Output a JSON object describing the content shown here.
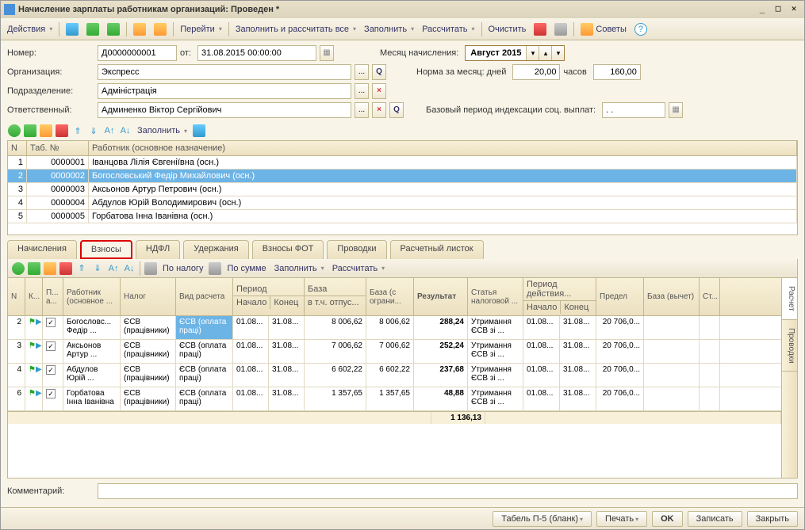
{
  "title": "Начисление зарплаты работникам организаций: Проведен *",
  "toolbar": {
    "actions": "Действия",
    "goto": "Перейти",
    "fill_calc_all": "Заполнить и рассчитать все",
    "fill": "Заполнить",
    "calc": "Рассчитать",
    "clear": "Очистить",
    "tips": "Советы"
  },
  "form": {
    "number_label": "Номер:",
    "number_value": "Д0000000001",
    "date_label": "от:",
    "date_value": "31.08.2015 00:00:00",
    "org_label": "Организация:",
    "org_value": "Экспресс",
    "dept_label": "Подразделение:",
    "dept_value": "Адміністрація",
    "resp_label": "Ответственный:",
    "resp_value": "Админенко Віктор Сергійович",
    "month_label": "Месяц начисления:",
    "month_value": "Август 2015",
    "norm_label": "Норма за месяц: дней",
    "norm_days": "20,00",
    "norm_hours_label": "часов",
    "norm_hours": "160,00",
    "base_period_label": "Базовый период индексации соц. выплат:",
    "base_period_value": ". ."
  },
  "mini_tb": {
    "fill": "Заполнить"
  },
  "emp_grid": {
    "col_n": "N",
    "col_tab": "Таб. №",
    "col_emp": "Работник (основное назначение)",
    "rows": [
      {
        "n": "1",
        "tab": "0000001",
        "emp": "Іванцова Лілія Євгеніївна (осн.)"
      },
      {
        "n": "2",
        "tab": "0000002",
        "emp": "Богословський Федір Михайлович (осн.)"
      },
      {
        "n": "3",
        "tab": "0000003",
        "emp": "Аксьонов Артур Петрович (осн.)"
      },
      {
        "n": "4",
        "tab": "0000004",
        "emp": "Абдулов Юрій Володимирович (осн.)"
      },
      {
        "n": "5",
        "tab": "0000005",
        "emp": "Горбатова Інна Іванівна (осн.)"
      }
    ]
  },
  "tabs": {
    "accruals": "Начисления",
    "contrib": "Взносы",
    "ndfl": "НДФЛ",
    "deduct": "Удержания",
    "contrib_fot": "Взносы ФОТ",
    "entries": "Проводки",
    "payslip": "Расчетный листок"
  },
  "sub_tb": {
    "by_tax": "По налогу",
    "by_sum": "По сумме",
    "fill": "Заполнить",
    "calc": "Рассчитать"
  },
  "detail": {
    "cols": {
      "n": "N",
      "k": "К...",
      "p": "П... а...",
      "emp": "Работник (основное ...",
      "tax": "Налог",
      "calc_type": "Вид расчета",
      "period": "Период",
      "period_start": "Начало",
      "period_end": "Конец",
      "base": "База",
      "base_vac": "в т.ч. отпус...",
      "base_lim": "База (с ограни...",
      "result": "Результат",
      "article": "Статья налоговой ...",
      "action_period": "Период действия...",
      "ap_start": "Начало",
      "ap_end": "Конец",
      "limit": "Предел",
      "base_ded": "База (вычет)",
      "st": "Ст..."
    },
    "rows": [
      {
        "n": "2",
        "emp": "Богословс... Федір ...",
        "tax": "ЄСВ (працівники)",
        "calc": "ЄСВ (оплата праці)",
        "ps": "01.08...",
        "pe": "31.08...",
        "base": "8 006,62",
        "base_lim": "8 006,62",
        "result": "288,24",
        "article": "Утримання ЄСВ зі ...",
        "aps": "01.08...",
        "ape": "31.08...",
        "limit": "20 706,0..."
      },
      {
        "n": "3",
        "emp": "Аксьонов Артур ...",
        "tax": "ЄСВ (працівники)",
        "calc": "ЄСВ (оплата праці)",
        "ps": "01.08...",
        "pe": "31.08...",
        "base": "7 006,62",
        "base_lim": "7 006,62",
        "result": "252,24",
        "article": "Утримання ЄСВ зі ...",
        "aps": "01.08...",
        "ape": "31.08...",
        "limit": "20 706,0..."
      },
      {
        "n": "4",
        "emp": "Абдулов Юрій ...",
        "tax": "ЄСВ (працівники)",
        "calc": "ЄСВ (оплата праці)",
        "ps": "01.08...",
        "pe": "31.08...",
        "base": "6 602,22",
        "base_lim": "6 602,22",
        "result": "237,68",
        "article": "Утримання ЄСВ зі ...",
        "aps": "01.08...",
        "ape": "31.08...",
        "limit": "20 706,0..."
      },
      {
        "n": "6",
        "emp": "Горбатова Інна Іванівна",
        "tax": "ЄСВ (працівники)",
        "calc": "ЄСВ (оплата праці)",
        "ps": "01.08...",
        "pe": "31.08...",
        "base": "1 357,65",
        "base_lim": "1 357,65",
        "result": "48,88",
        "article": "Утримання ЄСВ зі ...",
        "aps": "01.08...",
        "ape": "31.08...",
        "limit": "20 706,0..."
      }
    ],
    "total_result": "1 136,13"
  },
  "side_tabs": {
    "calc": "Расчет",
    "entries": "Проводки"
  },
  "footer": {
    "comment_label": "Комментарий:",
    "tabel": "Табель П-5 (бланк)",
    "print": "Печать",
    "ok": "OK",
    "save": "Записать",
    "close": "Закрыть"
  }
}
